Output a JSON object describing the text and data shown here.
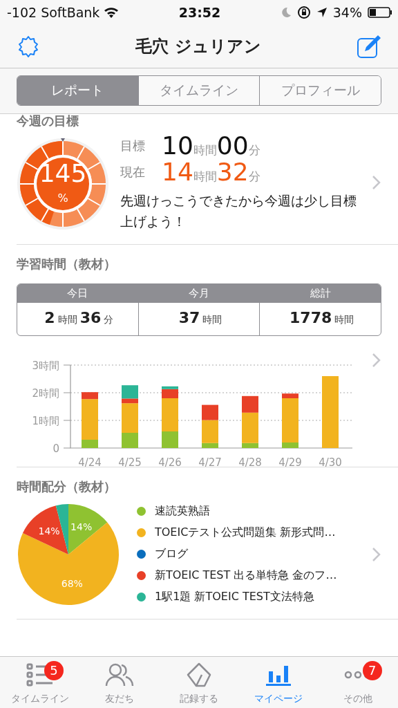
{
  "status_bar": {
    "carrier": "-102 SoftBank",
    "time": "23:52",
    "battery": "34%"
  },
  "nav": {
    "title": "毛穴 ジュリアン"
  },
  "segments": [
    {
      "label": "レポート",
      "selected": true
    },
    {
      "label": "タイムライン",
      "selected": false
    },
    {
      "label": "プロフィール",
      "selected": false
    }
  ],
  "weekly_goal": {
    "heading": "今週の目標",
    "percent": "145",
    "percent_unit": "%",
    "rows": [
      {
        "kind": "target",
        "label": "目標",
        "hours": "10",
        "hours_unit": "時間",
        "minutes": "00",
        "minutes_unit": "分"
      },
      {
        "kind": "current",
        "label": "現在",
        "hours": "14",
        "hours_unit": "時間",
        "minutes": "32",
        "minutes_unit": "分"
      }
    ],
    "comment": "先週けっこうできたから今週は少し目標上げよう！"
  },
  "study_time": {
    "heading": "学習時間（教材）",
    "columns": [
      {
        "label": "今日",
        "parts": [
          {
            "kind": "num",
            "text": "2"
          },
          {
            "kind": "unit",
            "text": "時間"
          },
          {
            "kind": "num",
            "text": "36"
          },
          {
            "kind": "unit",
            "text": "分"
          }
        ]
      },
      {
        "label": "今月",
        "parts": [
          {
            "kind": "num",
            "text": "37"
          },
          {
            "kind": "unit",
            "text": "時間"
          }
        ]
      },
      {
        "label": "総計",
        "parts": [
          {
            "kind": "num",
            "text": "1778"
          },
          {
            "kind": "unit",
            "text": "時間"
          }
        ]
      }
    ],
    "chart_data": {
      "type": "bar",
      "stacked": true,
      "categories": [
        "4/24",
        "4/25",
        "4/26",
        "4/27",
        "4/28",
        "4/29",
        "4/30"
      ],
      "ylim": [
        0,
        3
      ],
      "yticks": [
        {
          "value": 0,
          "label": "0"
        },
        {
          "value": 1,
          "label": "1時間"
        },
        {
          "value": 2,
          "label": "2時間"
        },
        {
          "value": 3,
          "label": "3時間"
        }
      ],
      "series": [
        {
          "color": "#8fc231",
          "values": [
            0.3,
            0.55,
            0.6,
            0.18,
            0.18,
            0.2,
            0
          ]
        },
        {
          "color": "#f2b31f",
          "values": [
            1.47,
            1.07,
            1.2,
            0.83,
            1.1,
            1.6,
            2.6
          ]
        },
        {
          "color": "#e84027",
          "values": [
            0.25,
            0.17,
            0.33,
            0.55,
            0.6,
            0.17,
            0
          ]
        },
        {
          "color": "#2bb596",
          "values": [
            0,
            0.48,
            0.1,
            0,
            0,
            0,
            0
          ]
        }
      ]
    }
  },
  "time_distribution": {
    "heading": "時間配分（教材）",
    "legend": [
      {
        "label": "速読英熟語",
        "color": "#8fc231"
      },
      {
        "label": "TOEICテスト公式問題集 新形式問…",
        "color": "#f2b31f"
      },
      {
        "label": "ブログ",
        "color": "#0a6ebd"
      },
      {
        "label": "新TOEIC TEST 出る単特急 金のフ…",
        "color": "#e84027"
      },
      {
        "label": "1駅1題  新TOEIC TEST文法特急",
        "color": "#2bb596"
      }
    ],
    "chart_data": {
      "type": "pie",
      "values": [
        14,
        68,
        0,
        14,
        4
      ],
      "value_labels": [
        "14%",
        "68%",
        null,
        "14%",
        null
      ]
    }
  },
  "tab_bar": [
    {
      "label": "タイムライン",
      "badge": "5",
      "selected": false
    },
    {
      "label": "友だち",
      "selected": false
    },
    {
      "label": "記録する",
      "selected": false
    },
    {
      "label": "マイページ",
      "selected": true
    },
    {
      "label": "その他",
      "badge": "7",
      "selected": false
    }
  ]
}
